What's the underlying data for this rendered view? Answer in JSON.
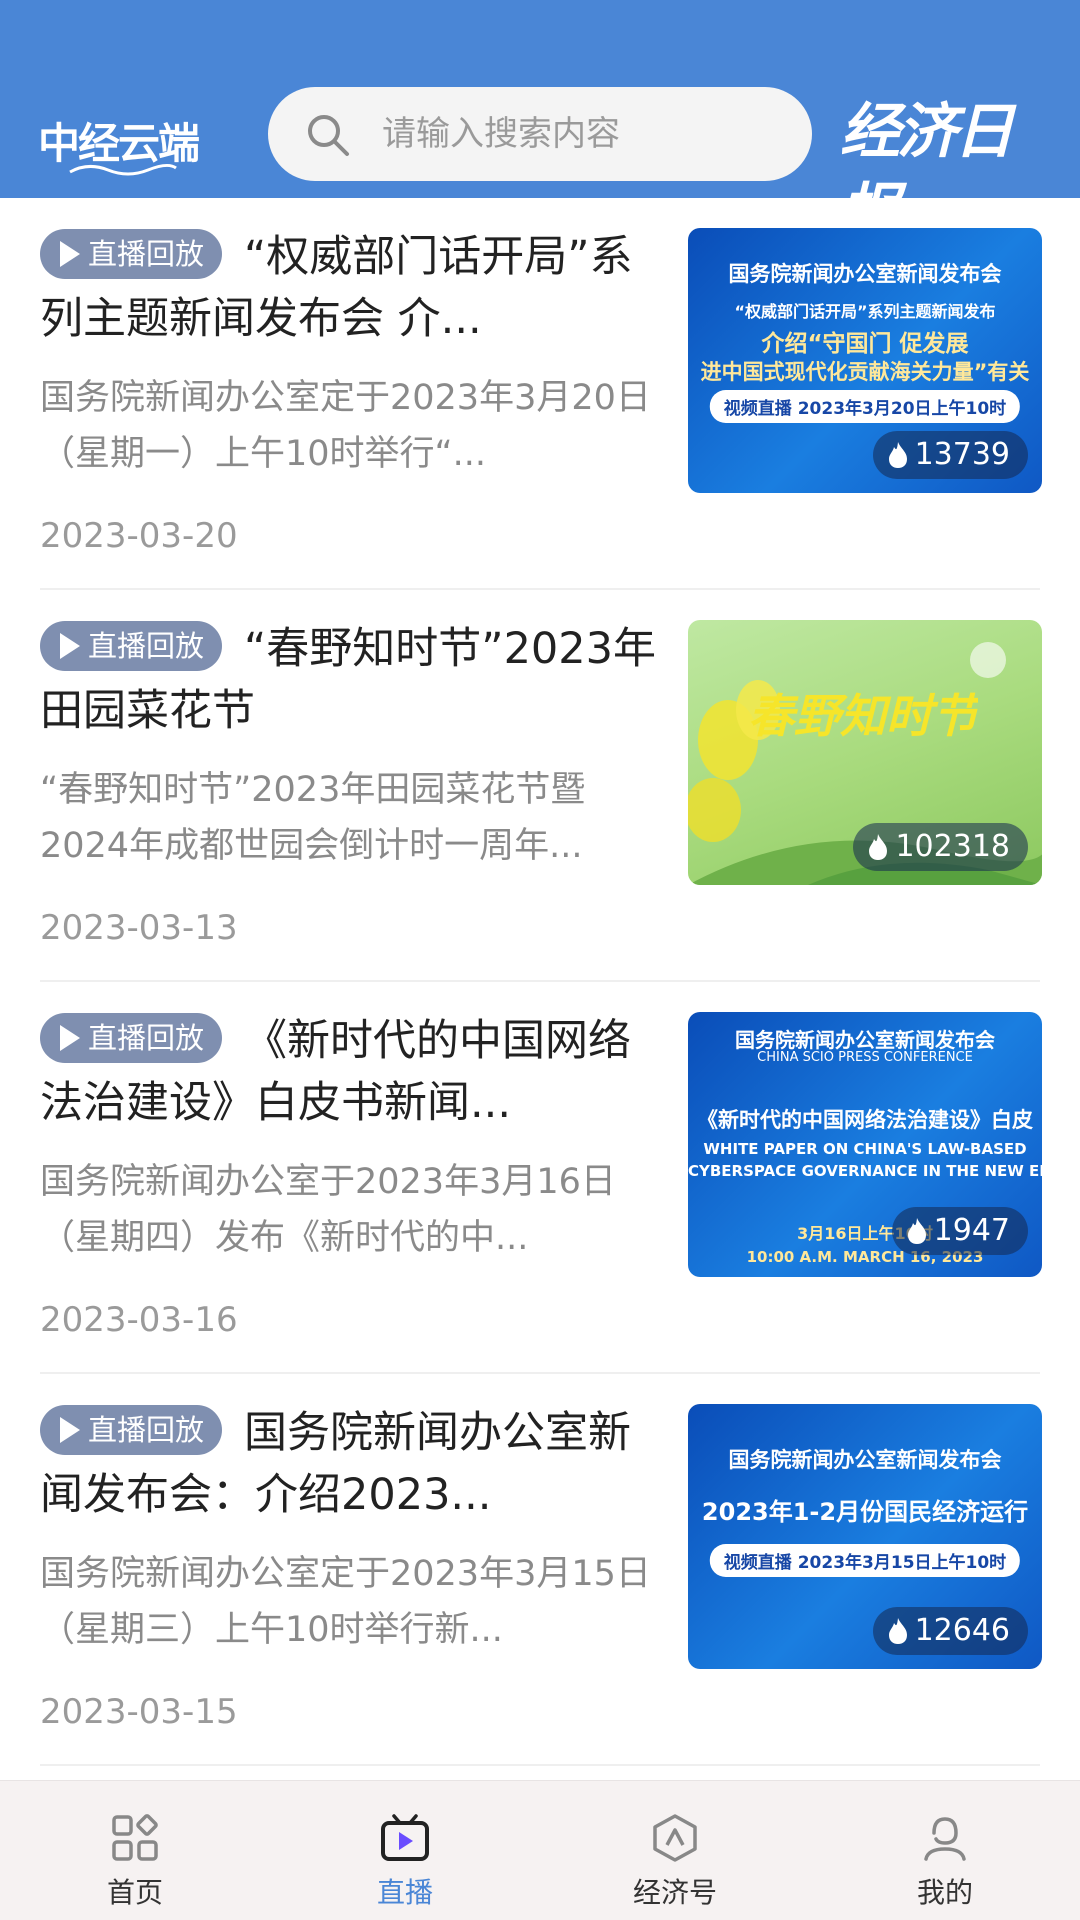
{
  "header": {
    "left_logo": "中经云端",
    "search_placeholder": "请输入搜索内容",
    "right_logo": "经济日报"
  },
  "items": [
    {
      "badge": "直播回放",
      "title": "“权威部门话开局”系列主题新闻发布会 介...",
      "desc": "国务院新闻办公室定于2023年3月20日（星期一）上午10时举行“...",
      "date": "2023-03-20",
      "views": "13739",
      "thumb": {
        "line1": "国务院新闻办公室新闻发布会",
        "line2": "“权威部门话开局”系列主题新闻发布",
        "line3": "介绍“守国门 促发展",
        "line4": "进中国式现代化贡献海关力量”有关",
        "pill": "视频直播 2023年3月20日上午10时"
      }
    },
    {
      "badge": "直播回放",
      "title": "“春野知时节”2023年田园菜花节",
      "desc": "“春野知时节”2023年田园菜花节暨2024年成都世园会倒计时一周年...",
      "date": "2023-03-13",
      "views": "102318",
      "thumb": {
        "line1": "春野知时节"
      }
    },
    {
      "badge": "直播回放",
      "title": "《新时代的中国网络法治建设》白皮书新闻...",
      "desc": "国务院新闻办公室于2023年3月16日（星期四）发布《新时代的中...",
      "date": "2023-03-16",
      "views": "1947",
      "thumb": {
        "line1": "国务院新闻办公室新闻发布会",
        "line2": "CHINA SCIO PRESS CONFERENCE",
        "line3": "《新时代的中国网络法治建设》白皮",
        "line4": "WHITE PAPER ON CHINA'S LAW-BASED",
        "line5": "CYBERSPACE GOVERNANCE IN THE NEW ERA",
        "line6": "3月16日上午10时",
        "line7": "10:00 A.M. MARCH 16, 2023"
      }
    },
    {
      "badge": "直播回放",
      "title": "国务院新闻办公室新闻发布会：介绍2023...",
      "desc": "国务院新闻办公室定于2023年3月15日（星期三）上午10时举行新...",
      "date": "2023-03-15",
      "views": "12646",
      "thumb": {
        "line1": "国务院新闻办公室新闻发布会",
        "line2": "2023年1-2月份国民经济运行",
        "pill": "视频直播 2023年3月15日上午10时"
      }
    }
  ],
  "nav": [
    {
      "label": "首页",
      "icon": "grid-icon",
      "active": false
    },
    {
      "label": "直播",
      "icon": "tv-play-icon",
      "active": true
    },
    {
      "label": "经济号",
      "icon": "hexagon-icon",
      "active": false
    },
    {
      "label": "我的",
      "icon": "user-icon",
      "active": false
    }
  ],
  "colors": {
    "header": "#4a86d6",
    "badge": "#7f8fb0",
    "accent": "#4a86d6"
  }
}
